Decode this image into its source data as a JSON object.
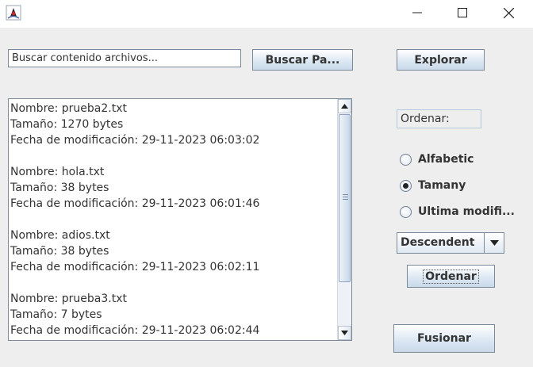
{
  "window": {
    "icon": "java-duke-icon",
    "controls": [
      "minimize",
      "maximize",
      "close"
    ]
  },
  "search": {
    "value": "Buscar contenido archivos...",
    "button_label": "Buscar Pa..."
  },
  "explorar_label": "Explorar",
  "results_text": "Nombre: prueba2.txt\nTamaño: 1270 bytes\nFecha de modificación: 29-11-2023 06:03:02\n\nNombre: hola.txt\nTamaño: 38 bytes\nFecha de modificación: 29-11-2023 06:01:46\n\nNombre: adios.txt\nTamaño: 38 bytes\nFecha de modificación: 29-11-2023 06:02:11\n\nNombre: prueba3.txt\nTamaño: 7 bytes\nFecha de modificación: 29-11-2023 06:02:44",
  "sort": {
    "label": "Ordenar:",
    "options": [
      {
        "label": "Alfabetic",
        "checked": false
      },
      {
        "label": "Tamany",
        "checked": true
      },
      {
        "label": "Ultima modifi...",
        "checked": false
      }
    ],
    "direction_value": "Descendent",
    "button_label": "Ordenar"
  },
  "fusionar_label": "Fusionar"
}
